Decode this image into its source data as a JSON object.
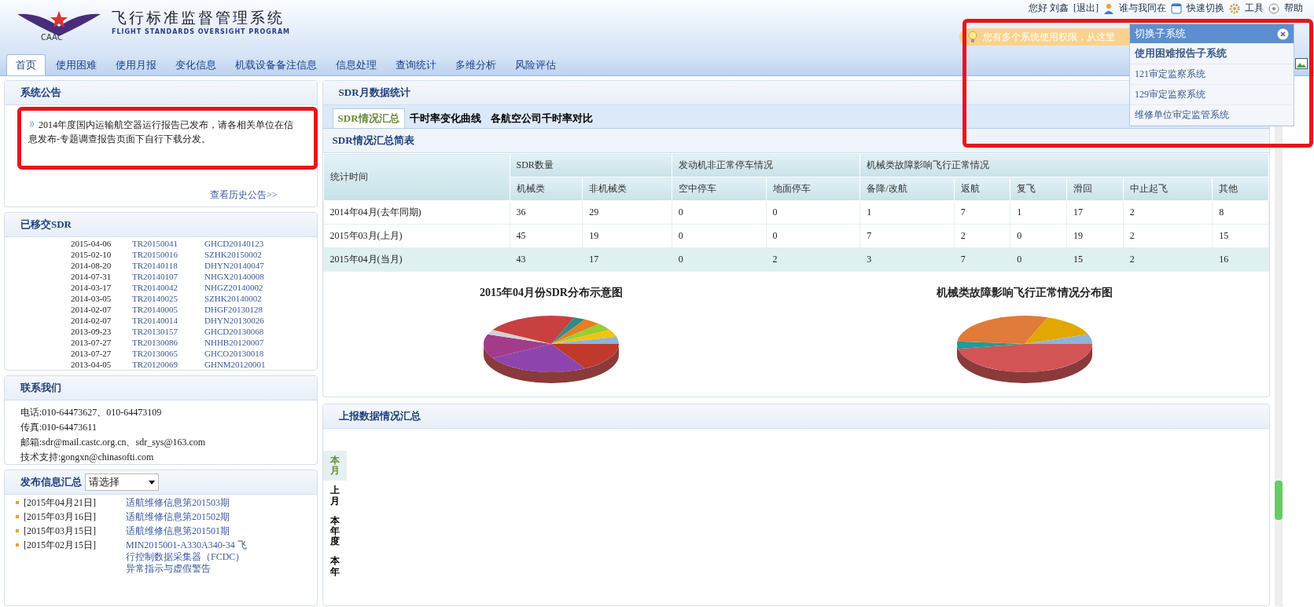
{
  "header": {
    "logo_text": "CAAC",
    "title": "飞行标准监督管理系统",
    "subtitle": "FLIGHT STANDARDS OVERSIGHT PROGRAM",
    "user_links": [
      {
        "kind": "text",
        "label": "您好 刘鑫"
      },
      {
        "kind": "text",
        "label": "[退出]"
      },
      {
        "kind": "person",
        "label": "谁与我同在"
      },
      {
        "kind": "switch",
        "label": "快速切换"
      },
      {
        "kind": "gear",
        "label": "工具"
      },
      {
        "kind": "help",
        "label": "帮助"
      }
    ],
    "notice": "您有多个系统使用权限，从这里"
  },
  "nav_tabs": [
    {
      "label": "首页",
      "selected": true
    },
    {
      "label": "使用困难",
      "selected": false
    },
    {
      "label": "使用月报",
      "selected": false
    },
    {
      "label": "变化信息",
      "selected": false
    },
    {
      "label": "机载设备备注信息",
      "selected": false
    },
    {
      "label": "信息处理",
      "selected": false
    },
    {
      "label": "查询统计",
      "selected": false
    },
    {
      "label": "多维分析",
      "selected": false
    },
    {
      "label": "风险评估",
      "selected": false
    }
  ],
  "subsystem_popup": {
    "title": "切换子系统",
    "items": [
      {
        "label": "使用困难报告子系统",
        "selected": true
      },
      {
        "label": "121审定监察系统",
        "selected": false
      },
      {
        "label": "129审定监察系统",
        "selected": false
      },
      {
        "label": "维修单位审定监管系统",
        "selected": false
      }
    ]
  },
  "announcement": {
    "title": "系统公告",
    "text": "2014年度国内运输航空器运行报告已发布，请各相关单位在信息发布-专题调查报告页面下自行下载分发。",
    "more_link": "查看历史公告>>"
  },
  "transferred_sdr": {
    "title": "已移交SDR",
    "rows": [
      {
        "date": "2015-04-06",
        "tr": "TR20150041",
        "code": "GHCD20140123"
      },
      {
        "date": "2015-02-10",
        "tr": "TR20150016",
        "code": "SZHK20150002"
      },
      {
        "date": "2014-08-20",
        "tr": "TR20140118",
        "code": "DHYN20140047"
      },
      {
        "date": "2014-07-31",
        "tr": "TR20140107",
        "code": "NHGX20140008"
      },
      {
        "date": "2014-03-17",
        "tr": "TR20140042",
        "code": "NHGZ20140002"
      },
      {
        "date": "2014-03-05",
        "tr": "TR20140025",
        "code": "SZHK20140002"
      },
      {
        "date": "2014-02-07",
        "tr": "TR20140005",
        "code": "DHGF20130128"
      },
      {
        "date": "2014-02-07",
        "tr": "TR20140014",
        "code": "DHYN20130026"
      },
      {
        "date": "2013-09-23",
        "tr": "TR20130157",
        "code": "GHCD20130068"
      },
      {
        "date": "2013-07-27",
        "tr": "TR20130086",
        "code": "NHHB20120007"
      },
      {
        "date": "2013-07-27",
        "tr": "TR20130065",
        "code": "GHCO20130018"
      },
      {
        "date": "2013-04-05",
        "tr": "TR20120069",
        "code": "GHNM20120001"
      }
    ]
  },
  "contact": {
    "title": "联系我们",
    "lines": [
      "电话:010-64473627、010-64473109",
      "传真:010-64473611",
      "邮箱:sdr@mail.castc.org.cn、sdr_sys@163.com",
      "技术支持:gongxn@chinasofti.com"
    ]
  },
  "publications": {
    "title": "发布信息汇总",
    "select_value": "请选择",
    "items": [
      {
        "date": "[2015年04月21日]",
        "title": "适航维修信息第201503期"
      },
      {
        "date": "[2015年03月16日]",
        "title": "适航维修信息第201502期"
      },
      {
        "date": "[2015年03月15日]",
        "title": "适航维修信息第201501期"
      },
      {
        "date": "[2015年02月15日]",
        "title": "MIN2015001-A330A340-34 飞行控制数据采集器（FCDC）异常指示与虚假警告"
      }
    ]
  },
  "sdr_stats": {
    "title": "SDR月数据统计",
    "tabs": [
      {
        "label": "SDR情况汇总",
        "selected": true
      },
      {
        "label": "千时率变化曲线",
        "selected": false
      },
      {
        "label": "各航空公司千时率对比",
        "selected": false
      }
    ],
    "table_title": "SDR情况汇总简表",
    "corner": "统计时间",
    "groups": [
      {
        "label": "SDR数量",
        "columns": [
          "机械类",
          "非机械类"
        ]
      },
      {
        "label": "发动机非正常停车情况",
        "columns": [
          "空中停车",
          "地面停车"
        ]
      },
      {
        "label": "机械类故障影响飞行正常情况",
        "columns": [
          "备降/改航",
          "返航",
          "复飞",
          "滑回",
          "中止起飞",
          "其他"
        ]
      }
    ],
    "rows": [
      {
        "period": "2014年04月(去年同期)",
        "highlighted": false,
        "values": [
          "36",
          "29",
          "0",
          "0",
          "1",
          "7",
          "1",
          "17",
          "2",
          "8"
        ]
      },
      {
        "period": "2015年03月(上月)",
        "highlighted": false,
        "values": [
          "45",
          "19",
          "0",
          "0",
          "7",
          "2",
          "0",
          "19",
          "2",
          "15"
        ]
      },
      {
        "period": "2015年04月(当月)",
        "highlighted": true,
        "values": [
          "43",
          "17",
          "0",
          "2",
          "3",
          "7",
          "0",
          "15",
          "2",
          "16"
        ]
      }
    ],
    "chart_titles": [
      "2015年04月份SDR分布示意图",
      "机械类故障影响飞行正常情况分布图"
    ]
  },
  "report_summary": {
    "title": "上报数据情况汇总",
    "period_tabs": [
      {
        "label": "本月",
        "selected": true
      },
      {
        "label": "上月",
        "selected": false
      },
      {
        "label": "本年度",
        "selected": false
      },
      {
        "label": "本年",
        "selected": false
      }
    ]
  }
}
